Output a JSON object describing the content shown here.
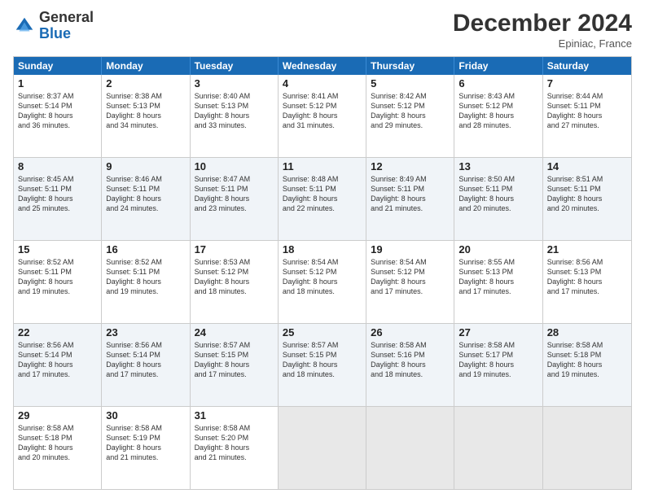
{
  "header": {
    "logo_general": "General",
    "logo_blue": "Blue",
    "month_title": "December 2024",
    "subtitle": "Epiniac, France"
  },
  "days_of_week": [
    "Sunday",
    "Monday",
    "Tuesday",
    "Wednesday",
    "Thursday",
    "Friday",
    "Saturday"
  ],
  "weeks": [
    {
      "alt": false,
      "cells": [
        {
          "day": "1",
          "lines": [
            "Sunrise: 8:37 AM",
            "Sunset: 5:14 PM",
            "Daylight: 8 hours",
            "and 36 minutes."
          ]
        },
        {
          "day": "2",
          "lines": [
            "Sunrise: 8:38 AM",
            "Sunset: 5:13 PM",
            "Daylight: 8 hours",
            "and 34 minutes."
          ]
        },
        {
          "day": "3",
          "lines": [
            "Sunrise: 8:40 AM",
            "Sunset: 5:13 PM",
            "Daylight: 8 hours",
            "and 33 minutes."
          ]
        },
        {
          "day": "4",
          "lines": [
            "Sunrise: 8:41 AM",
            "Sunset: 5:12 PM",
            "Daylight: 8 hours",
            "and 31 minutes."
          ]
        },
        {
          "day": "5",
          "lines": [
            "Sunrise: 8:42 AM",
            "Sunset: 5:12 PM",
            "Daylight: 8 hours",
            "and 29 minutes."
          ]
        },
        {
          "day": "6",
          "lines": [
            "Sunrise: 8:43 AM",
            "Sunset: 5:12 PM",
            "Daylight: 8 hours",
            "and 28 minutes."
          ]
        },
        {
          "day": "7",
          "lines": [
            "Sunrise: 8:44 AM",
            "Sunset: 5:11 PM",
            "Daylight: 8 hours",
            "and 27 minutes."
          ]
        }
      ]
    },
    {
      "alt": true,
      "cells": [
        {
          "day": "8",
          "lines": [
            "Sunrise: 8:45 AM",
            "Sunset: 5:11 PM",
            "Daylight: 8 hours",
            "and 25 minutes."
          ]
        },
        {
          "day": "9",
          "lines": [
            "Sunrise: 8:46 AM",
            "Sunset: 5:11 PM",
            "Daylight: 8 hours",
            "and 24 minutes."
          ]
        },
        {
          "day": "10",
          "lines": [
            "Sunrise: 8:47 AM",
            "Sunset: 5:11 PM",
            "Daylight: 8 hours",
            "and 23 minutes."
          ]
        },
        {
          "day": "11",
          "lines": [
            "Sunrise: 8:48 AM",
            "Sunset: 5:11 PM",
            "Daylight: 8 hours",
            "and 22 minutes."
          ]
        },
        {
          "day": "12",
          "lines": [
            "Sunrise: 8:49 AM",
            "Sunset: 5:11 PM",
            "Daylight: 8 hours",
            "and 21 minutes."
          ]
        },
        {
          "day": "13",
          "lines": [
            "Sunrise: 8:50 AM",
            "Sunset: 5:11 PM",
            "Daylight: 8 hours",
            "and 20 minutes."
          ]
        },
        {
          "day": "14",
          "lines": [
            "Sunrise: 8:51 AM",
            "Sunset: 5:11 PM",
            "Daylight: 8 hours",
            "and 20 minutes."
          ]
        }
      ]
    },
    {
      "alt": false,
      "cells": [
        {
          "day": "15",
          "lines": [
            "Sunrise: 8:52 AM",
            "Sunset: 5:11 PM",
            "Daylight: 8 hours",
            "and 19 minutes."
          ]
        },
        {
          "day": "16",
          "lines": [
            "Sunrise: 8:52 AM",
            "Sunset: 5:11 PM",
            "Daylight: 8 hours",
            "and 19 minutes."
          ]
        },
        {
          "day": "17",
          "lines": [
            "Sunrise: 8:53 AM",
            "Sunset: 5:12 PM",
            "Daylight: 8 hours",
            "and 18 minutes."
          ]
        },
        {
          "day": "18",
          "lines": [
            "Sunrise: 8:54 AM",
            "Sunset: 5:12 PM",
            "Daylight: 8 hours",
            "and 18 minutes."
          ]
        },
        {
          "day": "19",
          "lines": [
            "Sunrise: 8:54 AM",
            "Sunset: 5:12 PM",
            "Daylight: 8 hours",
            "and 17 minutes."
          ]
        },
        {
          "day": "20",
          "lines": [
            "Sunrise: 8:55 AM",
            "Sunset: 5:13 PM",
            "Daylight: 8 hours",
            "and 17 minutes."
          ]
        },
        {
          "day": "21",
          "lines": [
            "Sunrise: 8:56 AM",
            "Sunset: 5:13 PM",
            "Daylight: 8 hours",
            "and 17 minutes."
          ]
        }
      ]
    },
    {
      "alt": true,
      "cells": [
        {
          "day": "22",
          "lines": [
            "Sunrise: 8:56 AM",
            "Sunset: 5:14 PM",
            "Daylight: 8 hours",
            "and 17 minutes."
          ]
        },
        {
          "day": "23",
          "lines": [
            "Sunrise: 8:56 AM",
            "Sunset: 5:14 PM",
            "Daylight: 8 hours",
            "and 17 minutes."
          ]
        },
        {
          "day": "24",
          "lines": [
            "Sunrise: 8:57 AM",
            "Sunset: 5:15 PM",
            "Daylight: 8 hours",
            "and 17 minutes."
          ]
        },
        {
          "day": "25",
          "lines": [
            "Sunrise: 8:57 AM",
            "Sunset: 5:15 PM",
            "Daylight: 8 hours",
            "and 18 minutes."
          ]
        },
        {
          "day": "26",
          "lines": [
            "Sunrise: 8:58 AM",
            "Sunset: 5:16 PM",
            "Daylight: 8 hours",
            "and 18 minutes."
          ]
        },
        {
          "day": "27",
          "lines": [
            "Sunrise: 8:58 AM",
            "Sunset: 5:17 PM",
            "Daylight: 8 hours",
            "and 19 minutes."
          ]
        },
        {
          "day": "28",
          "lines": [
            "Sunrise: 8:58 AM",
            "Sunset: 5:18 PM",
            "Daylight: 8 hours",
            "and 19 minutes."
          ]
        }
      ]
    },
    {
      "alt": false,
      "cells": [
        {
          "day": "29",
          "lines": [
            "Sunrise: 8:58 AM",
            "Sunset: 5:18 PM",
            "Daylight: 8 hours",
            "and 20 minutes."
          ]
        },
        {
          "day": "30",
          "lines": [
            "Sunrise: 8:58 AM",
            "Sunset: 5:19 PM",
            "Daylight: 8 hours",
            "and 21 minutes."
          ]
        },
        {
          "day": "31",
          "lines": [
            "Sunrise: 8:58 AM",
            "Sunset: 5:20 PM",
            "Daylight: 8 hours",
            "and 21 minutes."
          ]
        },
        {
          "day": "",
          "lines": []
        },
        {
          "day": "",
          "lines": []
        },
        {
          "day": "",
          "lines": []
        },
        {
          "day": "",
          "lines": []
        }
      ]
    }
  ]
}
